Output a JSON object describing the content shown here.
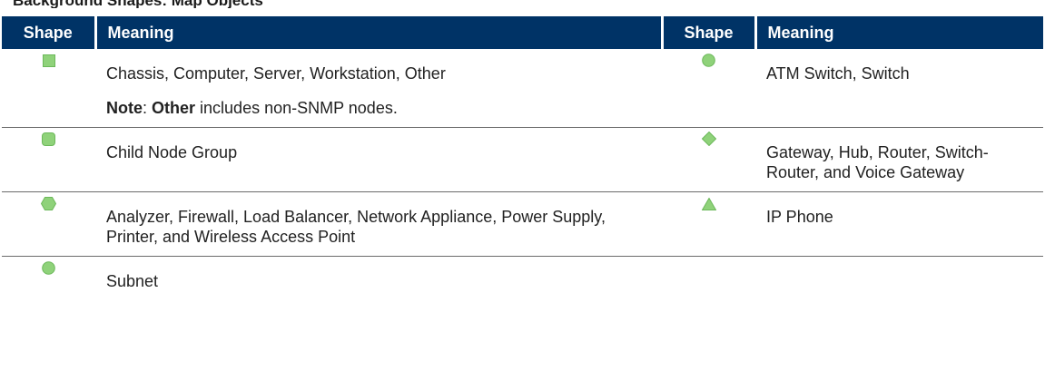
{
  "caption": "Background Shapes: Map Objects",
  "colors": {
    "header_bg": "#003366",
    "shape_fill": "#8fd27a",
    "shape_stroke": "#6cb85a"
  },
  "headers": {
    "shape": "Shape",
    "meaning": "Meaning"
  },
  "rows": [
    {
      "left": {
        "shape": "square-icon",
        "text": "Chassis, Computer, Server, Workstation, Other",
        "note_label": "Note",
        "note_sep": ": ",
        "note_term": "Other",
        "note_rest": " includes non-SNMP nodes."
      },
      "right": {
        "shape": "circle-icon",
        "text": "ATM Switch, Switch"
      }
    },
    {
      "left": {
        "shape": "rounded-square-icon",
        "text": "Child Node Group"
      },
      "right": {
        "shape": "diamond-icon",
        "text": "Gateway, Hub, Router, Switch-Router, and Voice Gateway"
      }
    },
    {
      "left": {
        "shape": "hexagon-icon",
        "text": "Analyzer, Firewall, Load Balancer, Network Appliance, Power Supply, Printer, and Wireless Access Point"
      },
      "right": {
        "shape": "triangle-icon",
        "text": "IP Phone"
      }
    },
    {
      "left": {
        "shape": "circle-icon",
        "text": "Subnet"
      }
    }
  ]
}
